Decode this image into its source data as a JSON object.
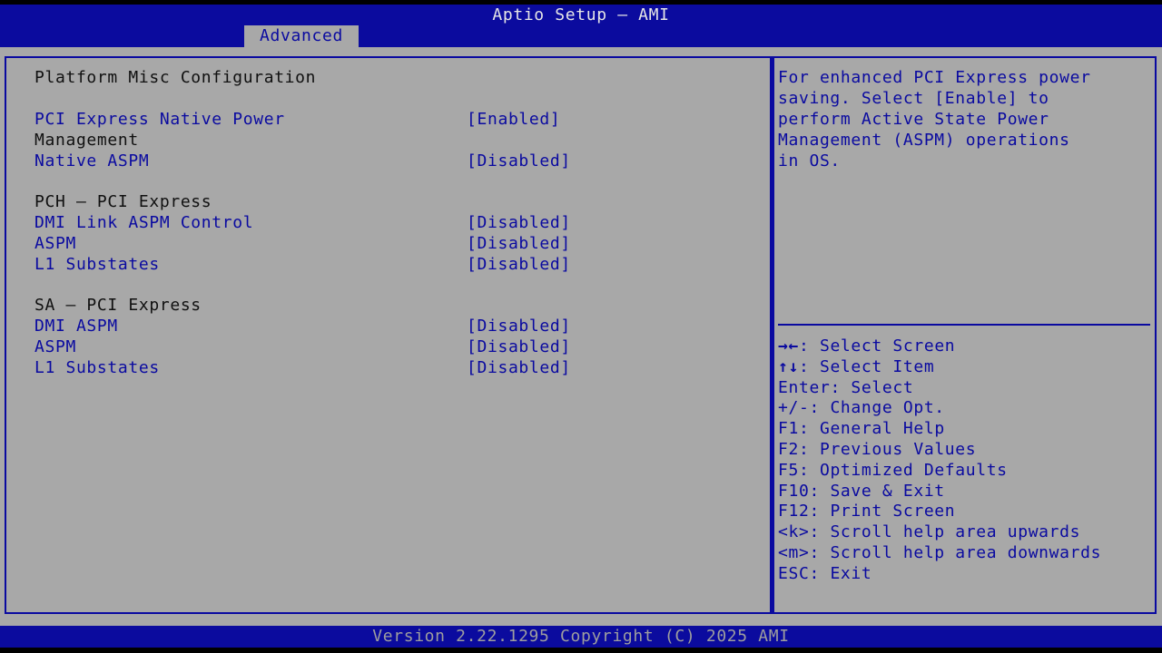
{
  "window": {
    "title": "Aptio Setup – AMI"
  },
  "tabs": [
    {
      "label": "Advanced",
      "selected": true
    }
  ],
  "page": {
    "title": "Platform Misc Configuration"
  },
  "settings": {
    "pci_native_power": {
      "label_line1": "PCI Express Native Power",
      "label_line2": "Management",
      "value": "[Enabled]"
    },
    "native_aspm": {
      "label": "Native ASPM",
      "value": "[Disabled]"
    },
    "pch_section": {
      "title": "PCH – PCI Express"
    },
    "pch_dmi_link_aspm": {
      "label": "DMI Link ASPM Control",
      "value": "[Disabled]"
    },
    "pch_aspm": {
      "label": "ASPM",
      "value": "[Disabled]"
    },
    "pch_l1": {
      "label": "L1 Substates",
      "value": "[Disabled]"
    },
    "sa_section": {
      "title": "SA – PCI Express"
    },
    "sa_dmi_aspm": {
      "label": "DMI ASPM",
      "value": "[Disabled]"
    },
    "sa_aspm": {
      "label": "ASPM",
      "value": "[Disabled]"
    },
    "sa_l1": {
      "label": "L1 Substates",
      "value": "[Disabled]"
    }
  },
  "help": {
    "lines": [
      "For enhanced PCI Express power",
      "saving. Select [Enable] to",
      "perform Active State Power",
      "Management (ASPM) operations",
      "in OS."
    ]
  },
  "keys": [
    {
      "key": "→←",
      "desc": ": Select Screen"
    },
    {
      "key": "↑↓",
      "desc": ": Select Item"
    },
    {
      "key": "Enter",
      "desc": ": Select"
    },
    {
      "key": "+/-",
      "desc": ": Change Opt."
    },
    {
      "key": "F1",
      "desc": ": General Help"
    },
    {
      "key": "F2",
      "desc": ": Previous Values"
    },
    {
      "key": "F5",
      "desc": ": Optimized Defaults"
    },
    {
      "key": "F10",
      "desc": ": Save & Exit"
    },
    {
      "key": "F12",
      "desc": ": Print Screen"
    },
    {
      "key": "<k>",
      "desc": ": Scroll help area upwards"
    },
    {
      "key": "<m>",
      "desc": ": Scroll help area downwards"
    },
    {
      "key": "ESC",
      "desc": ": Exit"
    }
  ],
  "footer": {
    "text": "Version 2.22.1295 Copyright (C) 2025 AMI"
  },
  "colors": {
    "header_blue": "#0b0b9e",
    "panel_gray": "#a8a8a8",
    "text_blue": "#0a0aa0"
  }
}
